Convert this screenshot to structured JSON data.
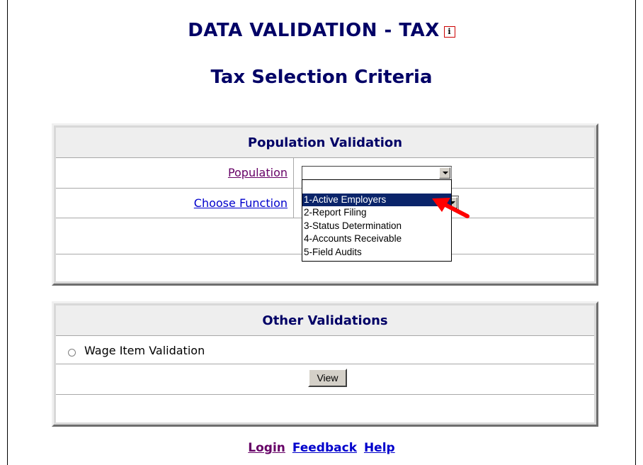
{
  "page": {
    "title": "DATA VALIDATION - TAX",
    "info_icon_glyph": "i",
    "subtitle": "Tax Selection Criteria"
  },
  "population_panel": {
    "header": "Population Validation",
    "population_label": "Population",
    "population_value": "",
    "choose_function_label": "Choose Function"
  },
  "dropdown": {
    "options": [
      "",
      "1-Active Employers",
      "2-Report Filing",
      "3-Status Determination",
      "4-Accounts Receivable",
      "5-Field Audits"
    ],
    "selected_index": 1
  },
  "other_panel": {
    "header": "Other Validations",
    "radio_label": "Wage Item Validation",
    "view_button": "View"
  },
  "footer": {
    "login": "Login",
    "feedback": "Feedback",
    "help": "Help"
  },
  "colors": {
    "heading": "#000066",
    "visited_link": "#660066",
    "link": "#0000cc",
    "selection": "#0a246a",
    "pointer_arrow": "#ff0000"
  }
}
